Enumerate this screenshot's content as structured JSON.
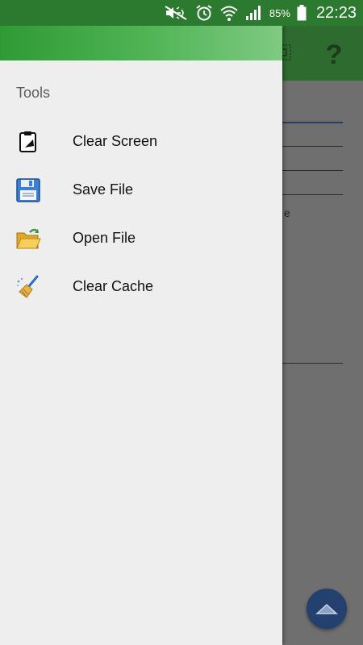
{
  "status_bar": {
    "battery_percent": "85%",
    "time": "22:23",
    "icons": [
      "mute-icon",
      "alarm-icon",
      "wifi-icon",
      "signal-icon",
      "battery-icon"
    ]
  },
  "app": {
    "toolbar_color": "#2d6b2e",
    "help_symbol": "?",
    "content_fragment": "e"
  },
  "drawer": {
    "header_color": "#3aa13f",
    "section_title": "Tools",
    "items": [
      {
        "label": "Clear Screen",
        "icon": "clipboard-clear-icon"
      },
      {
        "label": "Save File",
        "icon": "floppy-save-icon"
      },
      {
        "label": "Open File",
        "icon": "folder-open-icon"
      },
      {
        "label": "Clear Cache",
        "icon": "broom-icon"
      }
    ]
  },
  "fab": {
    "icon": "chevron-up-icon",
    "color": "#24406e"
  }
}
